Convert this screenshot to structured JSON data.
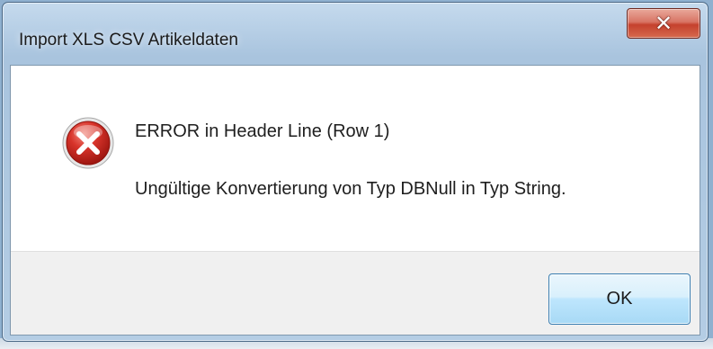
{
  "window": {
    "title": "Import XLS CSV Artikeldaten",
    "close_icon": "close-icon"
  },
  "message": {
    "icon": "error-icon",
    "title": "ERROR in Header Line (Row 1)",
    "body": "Ungültige Konvertierung von Typ DBNull in Typ String."
  },
  "buttons": {
    "ok_label": "OK"
  },
  "colors": {
    "close_button": "#c5412d",
    "error_icon": "#c8221b",
    "ok_button_border": "#3c7fb1"
  }
}
